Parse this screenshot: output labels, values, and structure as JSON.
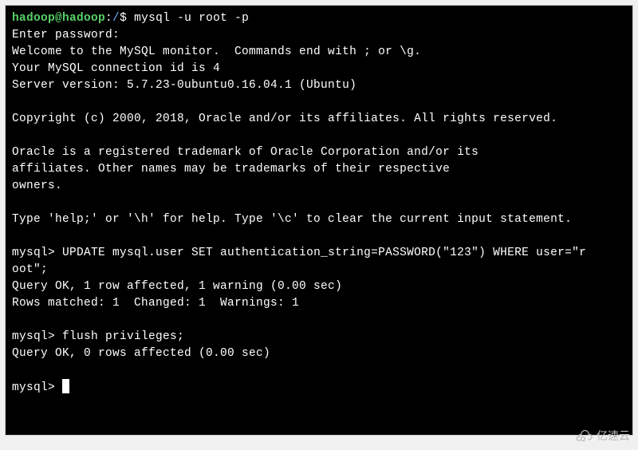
{
  "prompt": {
    "user": "hadoop@hadoop",
    "sep1": ":",
    "path": "/",
    "sep2": "$ ",
    "command": "mysql -u root -p"
  },
  "lines": {
    "enter_password": "Enter password:",
    "welcome": "Welcome to the MySQL monitor.  Commands end with ; or \\g.",
    "conn_id": "Your MySQL connection id is 4",
    "server_ver": "Server version: 5.7.23-0ubuntu0.16.04.1 (Ubuntu)",
    "copyright": "Copyright (c) 2000, 2018, Oracle and/or its affiliates. All rights reserved.",
    "oracle1": "Oracle is a registered trademark of Oracle Corporation and/or its",
    "oracle2": "affiliates. Other names may be trademarks of their respective",
    "oracle3": "owners.",
    "help": "Type 'help;' or '\\h' for help. Type '\\c' to clear the current input statement."
  },
  "mysql": {
    "prompt": "mysql> ",
    "update_stmt_part1": "UPDATE mysql.user SET authentication_string=PASSWORD(\"123\") WHERE user=\"r",
    "update_stmt_part2": "oot\";",
    "query_ok1": "Query OK, 1 row affected, 1 warning (0.00 sec)",
    "rows_matched": "Rows matched: 1  Changed: 1  Warnings: 1",
    "flush_stmt": "flush privileges;",
    "query_ok2": "Query OK, 0 rows affected (0.00 sec)"
  },
  "watermark": {
    "text": "亿速云"
  }
}
